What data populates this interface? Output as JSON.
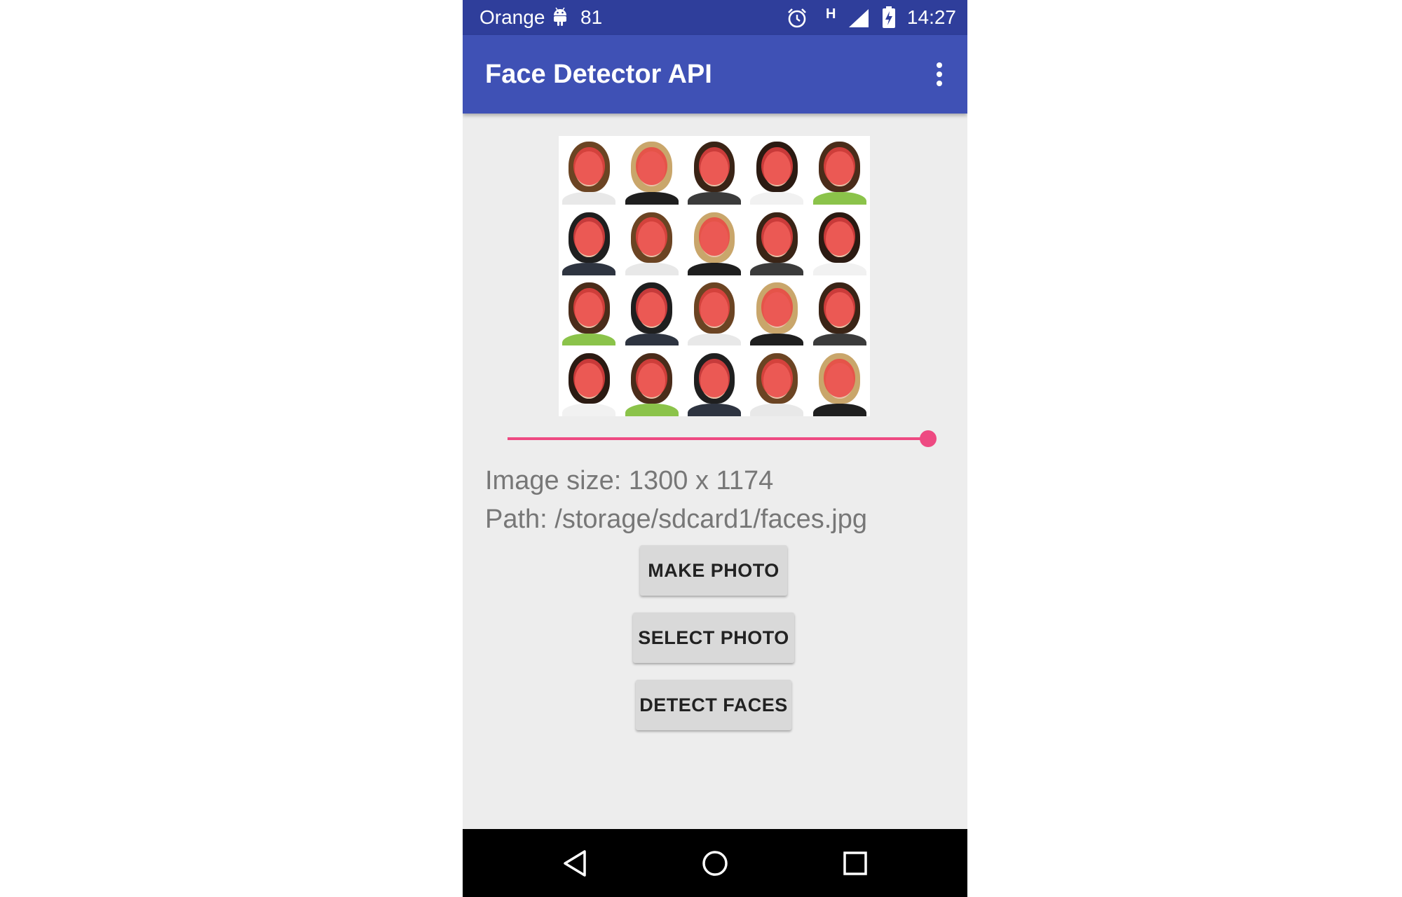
{
  "status_bar": {
    "carrier": "Orange",
    "battery_level": "81",
    "network_type": "H",
    "time": "14:27",
    "icons": [
      "android-icon",
      "alarm-icon",
      "signal-icon",
      "battery-charging-icon"
    ]
  },
  "app_bar": {
    "title": "Face Detector API",
    "menu_icon": "more-vert-icon"
  },
  "image": {
    "rows": 4,
    "columns": 5,
    "faces_detected_overlay": true,
    "overlay_color": "#ec4242"
  },
  "slider": {
    "value_fraction": 1.0,
    "accent_color": "#ee4a82"
  },
  "info": {
    "image_size": "Image size: 1300 x 1174",
    "path": "Path: /storage/sdcard1/faces.jpg"
  },
  "buttons": {
    "make_photo": "MAKE PHOTO",
    "select_photo": "SELECT PHOTO",
    "detect_faces": "DETECT FACES"
  },
  "nav_bar": {
    "icons": [
      "back-icon",
      "home-icon",
      "recents-icon"
    ]
  },
  "colors": {
    "primary": "#3f51b5",
    "primary_dark": "#2f3e9b",
    "background": "#ededed",
    "button": "#d9d9d9"
  }
}
